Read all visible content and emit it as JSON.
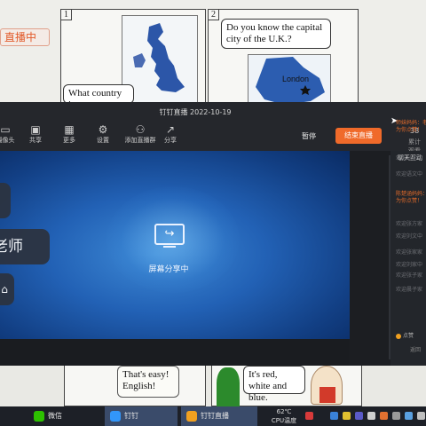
{
  "background_page": {
    "live_tag": "直播中",
    "panel1_number": "1",
    "panel2_number": "2",
    "bubble_question": "What country is",
    "bubble_capital": "Do you know the capital city of the U.K.?",
    "map_city": "London",
    "bubble_easy": "That's easy! English!",
    "bubble_colors": "It's red, white and blue."
  },
  "window": {
    "title": "钉钉直播 2022-10-19",
    "toolbar": [
      {
        "label": "摄像头",
        "icon": "camera-icon"
      },
      {
        "label": "共享",
        "icon": "screen-share-icon"
      },
      {
        "label": "更多",
        "icon": "more-icon"
      },
      {
        "label": "设置",
        "icon": "gear-icon"
      },
      {
        "label": "添加直播群",
        "icon": "add-group-icon"
      },
      {
        "label": "分享",
        "icon": "share-icon"
      }
    ],
    "mute_label": "暂停",
    "end_live_label": "结束直播",
    "stats_number": "38",
    "stats_label": "累计观看",
    "screen_share_label": "屏幕分享中",
    "speaker_name_fragment": "老师",
    "side_tab": "聊天互动",
    "chat_messages": [
      {
        "text": "师妹妈妈：老",
        "color": "orange"
      },
      {
        "text": "为你点赞！",
        "color": "orange"
      },
      {
        "text": "欢迎以前中",
        "color": "gray"
      },
      {
        "text": "欢迎语文中",
        "color": "gray"
      },
      {
        "text": "陈楚涵妈妈：",
        "color": "orange"
      },
      {
        "text": "为你点赞！",
        "color": "orange"
      },
      {
        "text": "欢迎张方家",
        "color": "gray"
      },
      {
        "text": "欢迎刘文中",
        "color": "gray"
      },
      {
        "text": "欢迎张家家",
        "color": "gray"
      },
      {
        "text": "欢迎刘家中",
        "color": "gray"
      },
      {
        "text": "欢迎张子家",
        "color": "gray"
      },
      {
        "text": "欢迎晨子家",
        "color": "gray"
      }
    ],
    "like_label": "点赞",
    "back_label": "返回"
  },
  "taskbar": {
    "apps": [
      {
        "label": "微信",
        "color": "#2dc100"
      },
      {
        "label": "钉钉",
        "color": "#3296fa"
      },
      {
        "label": "钉钉直播",
        "color": "#f0a020"
      }
    ],
    "temperature": "62℃",
    "temp_label": "CPU温度"
  },
  "colors": {
    "accent_end_live": "#f06a2a",
    "chat_highlight": "#e06a2a",
    "share_background": "#2261b5"
  }
}
